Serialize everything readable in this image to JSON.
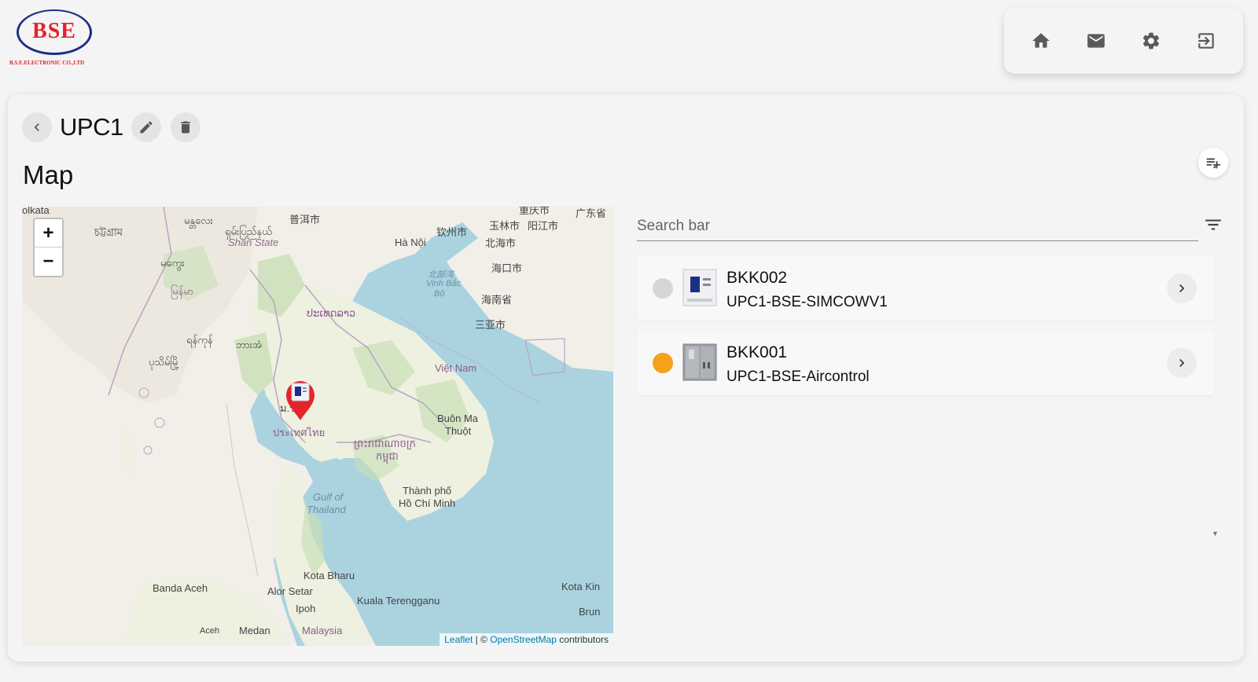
{
  "header": {
    "logo_text": "BSE",
    "logo_sub": "B.S.E.ELECTRONIC CO.,LTD",
    "nav": [
      {
        "icon": "home-icon"
      },
      {
        "icon": "mail-icon"
      },
      {
        "icon": "gear-icon"
      },
      {
        "icon": "logout-icon"
      }
    ]
  },
  "page": {
    "title": "UPC1",
    "section_title": "Map"
  },
  "map": {
    "zoom_in": "+",
    "zoom_out": "−",
    "attribution": {
      "leaflet": "Leaflet",
      "sep": " | © ",
      "osm": "OpenStreetMap",
      "suffix": " contributors"
    },
    "labels": {
      "kolkata": "olkata",
      "chittagong": "চট্টগ্রাম",
      "manipur": "မန္တလေး",
      "shan_state_1": "ရှမ်းပြည်နယ်",
      "shan_state_2": "Shan State",
      "puer": "普洱市",
      "kunming_top": "重庆市",
      "guangdong": "广东省",
      "qinzhou": "钦州市",
      "yulin": "玉林市",
      "yangjiang": "阳江市",
      "beihai": "北海市",
      "hanoi": "Hà Nội",
      "haikou": "海口市",
      "tonkin_1": "北部湾",
      "tonkin_2": "Vịnh Bắc",
      "tonkin_3": "Bộ",
      "hainan": "海南省",
      "sanya": "三亚市",
      "magway": "မကွေး",
      "myanmar": "မြန်မာ",
      "laos": "ປະເທດລາວ",
      "yangon": "ရန်ကုန်",
      "bago": "ဘားအံ",
      "pathein": "ပုသိမ်မြို့",
      "vietnam": "Việt Nam",
      "thailand": "ประเทศไทย",
      "bangkok": "ม.ร.ร",
      "cambodia_1": "ព្រះរាជាណាចក្រ",
      "cambodia_2": "កម្ពុជា",
      "buon_1": "Buôn Ma",
      "buon_2": "Thuột",
      "gulf_1": "Gulf of",
      "gulf_2": "Thailand",
      "hcmc_1": "Thành phố",
      "hcmc_2": "Hồ Chí Minh",
      "kota_bharu": "Kota Bharu",
      "banda_aceh": "Banda Aceh",
      "alor_setar": "Alor Setar",
      "kota_kin": "Kota Kin",
      "ipoh": "Ipoh",
      "kuala_t": "Kuala Terengganu",
      "brun": "Brun",
      "medan": "Medan",
      "malaysia": "Malaysia",
      "aceh": "Aceh"
    }
  },
  "search": {
    "placeholder": "Search bar",
    "value": ""
  },
  "devices": [
    {
      "name": "BKK002",
      "sub": "UPC1-BSE-SIMCOWV1",
      "status_color": "#d6d6d6"
    },
    {
      "name": "BKK001",
      "sub": "UPC1-BSE-Aircontrol",
      "status_color": "#f5a11a"
    }
  ],
  "colors": {
    "brand_red": "#e4232a",
    "brand_blue": "#1c2f86",
    "marker_red": "#e3242b"
  }
}
